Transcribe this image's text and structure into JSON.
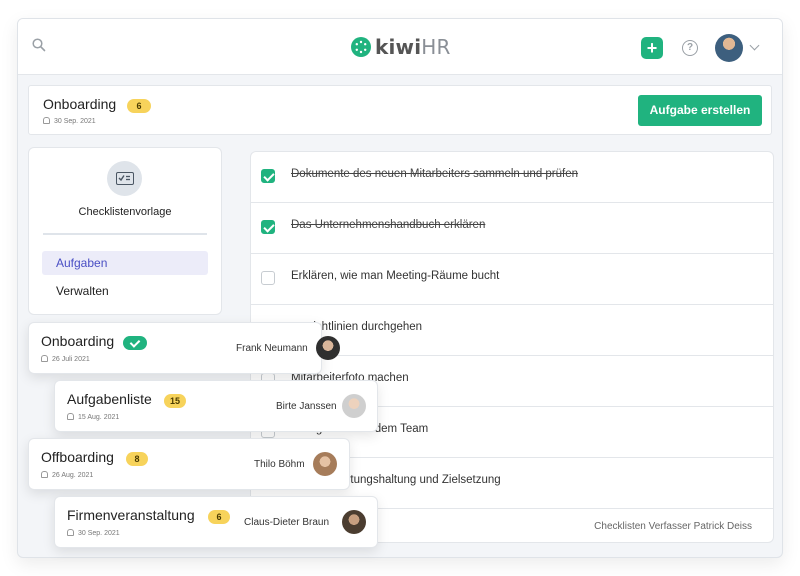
{
  "app": {
    "logo_main": "kiwi",
    "logo_accent": "HR",
    "add_label": "+",
    "help_label": "?"
  },
  "header": {
    "title": "Onboarding",
    "badge": "6",
    "date": "30 Sep. 2021",
    "create_button": "Aufgabe erstellen"
  },
  "sidebar": {
    "template_label": "Checklistenvorlage",
    "items": [
      {
        "label": "Aufgaben",
        "active": true
      },
      {
        "label": "Verwalten",
        "active": false
      }
    ]
  },
  "tasks": [
    {
      "text": "Dokumente des neuen Mitarbeiters sammeln und prüfen",
      "done": true
    },
    {
      "text": "Das Unternehmenshandbuch erklären",
      "done": true
    },
    {
      "text": "Erklären, wie man Meeting-Räume bucht",
      "done": false
    },
    {
      "text": "ensrichtlinien durchgehen",
      "done": false
    },
    {
      "text": "Mitarbeiterfoto machen",
      "done": false
    },
    {
      "text": "Mittagessen mit dem Team",
      "done": false
    },
    {
      "text": "g der Erwartungshaltung und Zielsetzung",
      "done": false
    }
  ],
  "author_text": "Checklisten Verfasser Patrick Deiss",
  "cards": [
    {
      "title": "Onboarding",
      "badge": "",
      "complete": true,
      "date": "26 Juli 2021",
      "person": "Frank Neumann",
      "avatar_color": "#3a3a3a"
    },
    {
      "title": "Aufgabenliste",
      "badge": "15",
      "complete": false,
      "date": "15 Aug. 2021",
      "person": "Birte Janssen",
      "avatar_color": "#c9a58c"
    },
    {
      "title": "Offboarding",
      "badge": "8",
      "complete": false,
      "date": "26 Aug. 2021",
      "person": "Thilo Böhm",
      "avatar_color": "#b08a6a"
    },
    {
      "title": "Firmenveranstaltung",
      "badge": "6",
      "complete": false,
      "date": "30 Sep. 2021",
      "person": "Claus-Dieter Braun",
      "avatar_color": "#6b5846"
    }
  ],
  "colors": {
    "accent": "#20b37f",
    "badge": "#f7d35b",
    "nav_active_bg": "#ececf9",
    "nav_active_text": "#4a4fc4"
  }
}
